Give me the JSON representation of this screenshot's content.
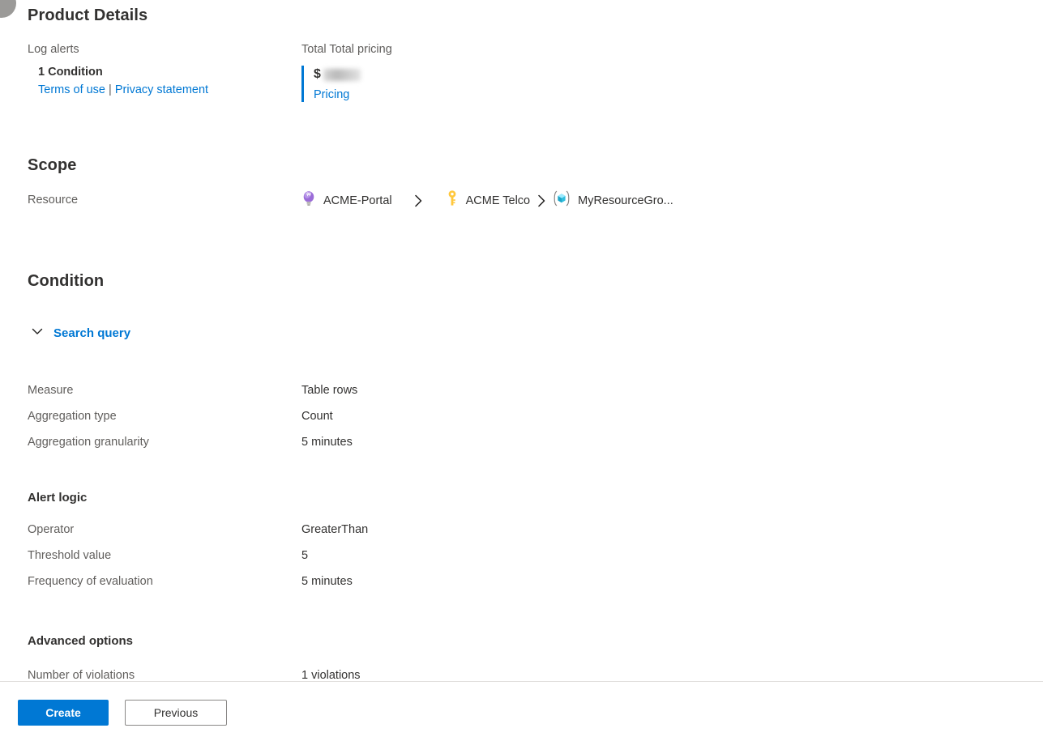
{
  "product_details": {
    "title": "Product Details",
    "left": {
      "label": "Log alerts",
      "condition_count": "1 Condition",
      "terms_link": "Terms of use",
      "separator": "|",
      "privacy_link": "Privacy statement"
    },
    "right": {
      "label": "Total Total pricing",
      "currency_symbol": "$",
      "price_value": "",
      "pricing_link": "Pricing"
    }
  },
  "scope": {
    "title": "Scope",
    "resource_label": "Resource",
    "breadcrumb": [
      {
        "label": "ACME-Portal",
        "icon": "lightbulb-icon"
      },
      {
        "label": "ACME Telco",
        "icon": "key-icon"
      },
      {
        "label": "MyResourceGro...",
        "icon": "resource-group-icon"
      }
    ],
    "separator_icon": "chevron-right-icon"
  },
  "condition": {
    "title": "Condition",
    "search_query_label": "Search query",
    "search_query_icon": "chevron-down-icon",
    "measure_rows": [
      {
        "key": "Measure",
        "value": "Table rows"
      },
      {
        "key": "Aggregation type",
        "value": "Count"
      },
      {
        "key": "Aggregation granularity",
        "value": "5 minutes"
      }
    ],
    "alert_logic": {
      "title": "Alert logic",
      "rows": [
        {
          "key": "Operator",
          "value": "GreaterThan"
        },
        {
          "key": "Threshold value",
          "value": "5"
        },
        {
          "key": "Frequency of evaluation",
          "value": "5 minutes"
        }
      ]
    },
    "advanced_options": {
      "title": "Advanced options",
      "rows": [
        {
          "key": "Number of violations",
          "value": "1 violations"
        }
      ]
    }
  },
  "footer": {
    "create_label": "Create",
    "previous_label": "Previous"
  },
  "colors": {
    "accent": "#0078d4",
    "text": "#323130",
    "muted": "#605e5c",
    "divider": "#e1dfdd"
  }
}
